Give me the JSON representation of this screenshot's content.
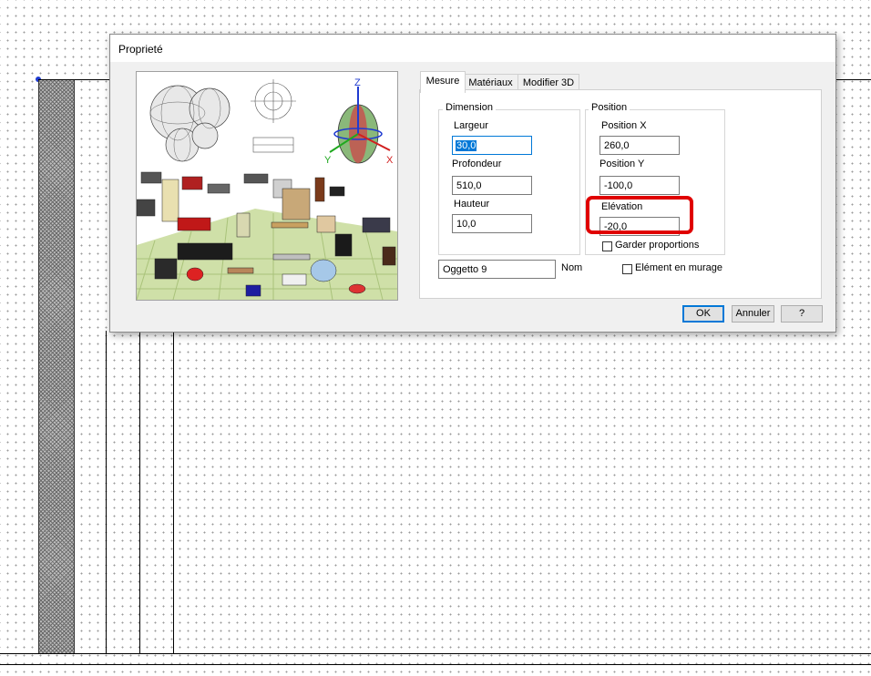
{
  "dialog": {
    "title": "Proprieté",
    "tabs": [
      "Mesure",
      "Matériaux",
      "Modifier 3D"
    ],
    "dimension": {
      "group_label": "Dimension",
      "largeur_label": "Largeur",
      "largeur_value": "30,0",
      "profondeur_label": "Profondeur",
      "profondeur_value": "510,0",
      "hauteur_label": "Hauteur",
      "hauteur_value": "10,0"
    },
    "position": {
      "group_label": "Position",
      "x_label": "Position X",
      "x_value": "260,0",
      "y_label": "Position Y",
      "y_value": "-100,0",
      "elevation_label": "Elévation",
      "elevation_value": "-20,0",
      "keep_proportions_label": "Garder proportions",
      "keep_proportions_checked": false
    },
    "name_value": "Oggetto 9",
    "name_label": "Nom",
    "wall_element_label": "Elément en murage",
    "wall_element_checked": false,
    "buttons": {
      "ok": "OK",
      "cancel": "Annuler",
      "help": "?"
    },
    "axis_labels": {
      "z": "Z",
      "y": "Y",
      "x": "X"
    }
  },
  "colors": {
    "accent": "#0078d7",
    "highlight": "#e00000",
    "axis_z": "#1f3bd1",
    "axis_y": "#1fa81f",
    "axis_x": "#d11f1f"
  }
}
